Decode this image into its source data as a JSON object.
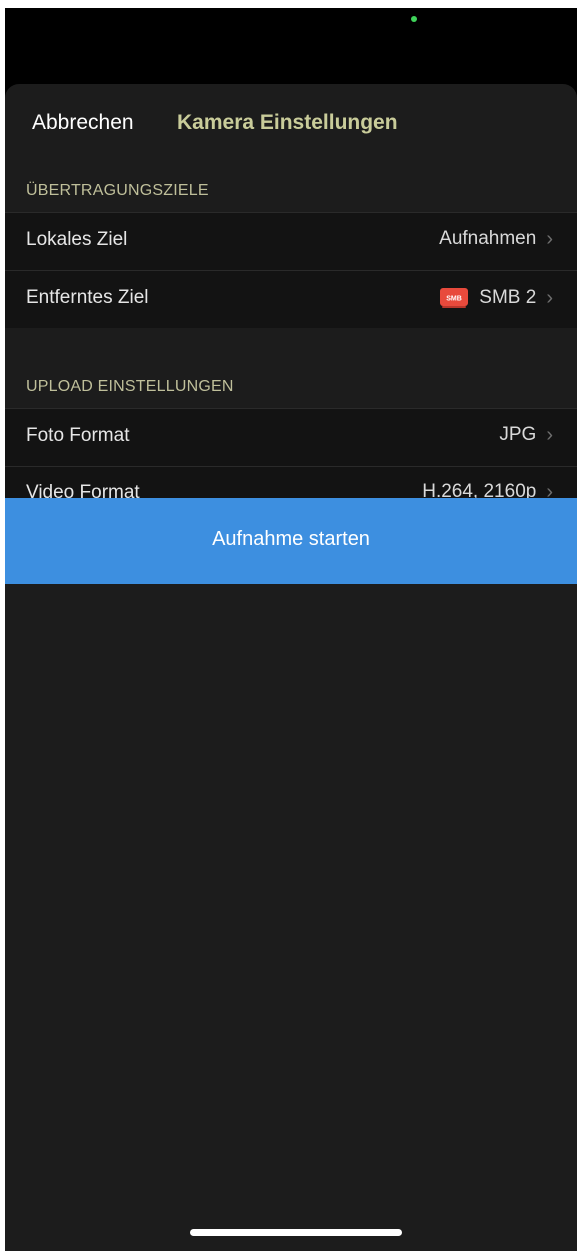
{
  "nav": {
    "cancel_label": "Abbrechen",
    "title": "Kamera Einstellungen"
  },
  "sections": {
    "transfer": {
      "header": "ÜBERTRAGUNGSZIELE",
      "rows": [
        {
          "label": "Lokales Ziel",
          "value": "Aufnahmen"
        },
        {
          "label": "Entferntes Ziel",
          "value": "SMB 2",
          "icon": "smb-drive-icon",
          "icon_text": "SMB"
        }
      ]
    },
    "upload": {
      "header": "UPLOAD EINSTELLUNGEN",
      "rows": [
        {
          "label": "Foto Format",
          "value": "JPG"
        },
        {
          "label": "Video Format",
          "value": "H.264, 2160p"
        }
      ]
    }
  },
  "start_button": {
    "label": "Aufnahme starten"
  },
  "colors": {
    "accent_button": "#3d8fe0",
    "title_color": "#c9cc9a",
    "smb_icon": "#e84a3c"
  }
}
